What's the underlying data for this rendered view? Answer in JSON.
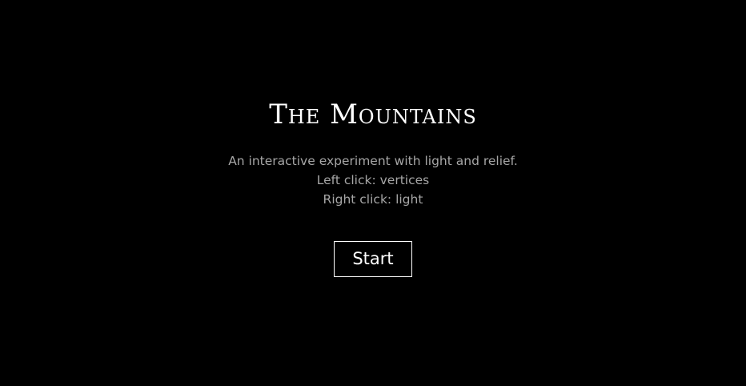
{
  "title": "The Mountains",
  "description": {
    "line1": "An interactive experiment with light and relief.",
    "line2": "Left click: vertices",
    "line3": "Right click: light"
  },
  "start_button": {
    "label": "Start"
  },
  "colors": {
    "background": "#000000",
    "title": "#ffffff",
    "description": "#a6a6a6",
    "button_border": "#ffffff"
  }
}
